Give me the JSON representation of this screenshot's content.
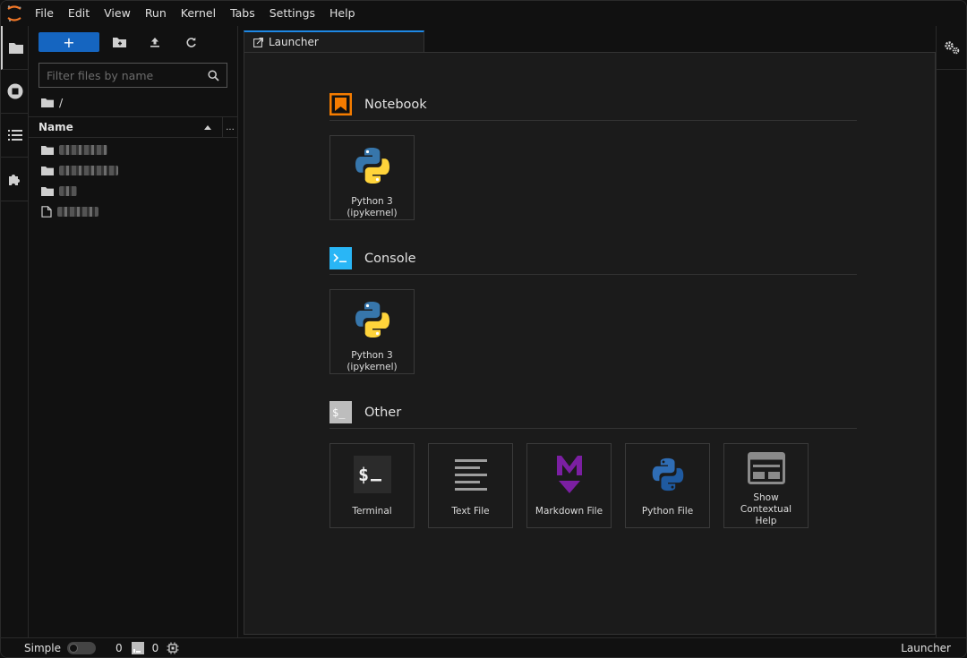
{
  "menubar": {
    "items": [
      "File",
      "Edit",
      "View",
      "Run",
      "Kernel",
      "Tabs",
      "Settings",
      "Help"
    ]
  },
  "filebrowser": {
    "new_label": "+",
    "filter_placeholder": "Filter files by name",
    "breadcrumb": "/",
    "column_name": "Name",
    "column_more": "...",
    "items": [
      {
        "type": "folder",
        "icon": "folder-icon"
      },
      {
        "type": "folder",
        "icon": "folder-icon"
      },
      {
        "type": "folder",
        "icon": "folder-icon"
      },
      {
        "type": "file",
        "icon": "file-icon"
      }
    ]
  },
  "tabs": [
    {
      "label": "Launcher",
      "icon": "launcher-icon"
    }
  ],
  "launcher": {
    "sections": [
      {
        "title": "Notebook",
        "cards": [
          {
            "line1": "Python 3",
            "line2": "(ipykernel)"
          }
        ]
      },
      {
        "title": "Console",
        "cards": [
          {
            "line1": "Python 3",
            "line2": "(ipykernel)"
          }
        ]
      },
      {
        "title": "Other",
        "cards": [
          {
            "label": "Terminal"
          },
          {
            "label": "Text File"
          },
          {
            "label": "Markdown File"
          },
          {
            "label": "Python File"
          },
          {
            "label": "Show Contextual Help",
            "line1": "Show Contextual",
            "line2": "Help"
          }
        ]
      }
    ]
  },
  "statusbar": {
    "mode_label": "Simple",
    "terminals_count": "0",
    "kernels_count": "0",
    "right_label": "Launcher"
  },
  "colors": {
    "accent": "#1565c0",
    "notebook": "#f57c00",
    "console": "#29b6f6",
    "markdown": "#7b1fa2",
    "python_blue": "#3776ab",
    "python_yellow": "#ffd43b"
  }
}
